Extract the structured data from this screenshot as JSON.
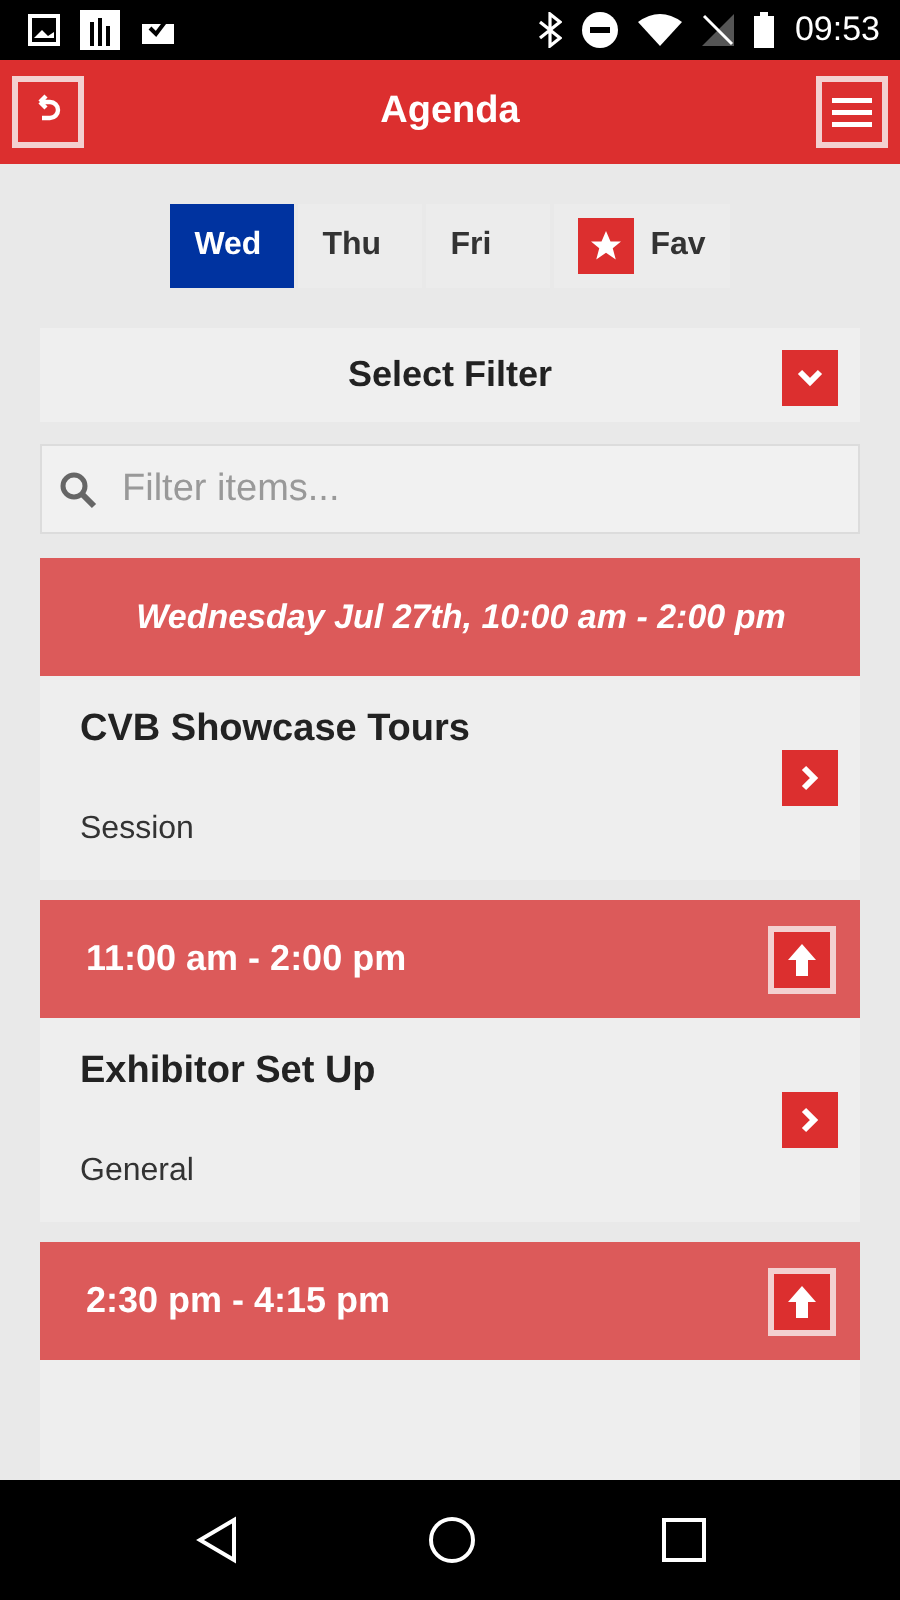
{
  "status_bar": {
    "time": "09:53"
  },
  "header": {
    "title": "Agenda"
  },
  "tabs": [
    {
      "label": "Wed",
      "selected": true,
      "kind": "day"
    },
    {
      "label": "Thu",
      "selected": false,
      "kind": "day"
    },
    {
      "label": "Fri",
      "selected": false,
      "kind": "day"
    },
    {
      "label": "Fav",
      "selected": false,
      "kind": "favorites"
    }
  ],
  "filter": {
    "label": "Select Filter",
    "expanded": false
  },
  "search": {
    "placeholder": "Filter items..."
  },
  "sections": [
    {
      "kind": "day",
      "title": "Wednesday Jul 27th, 10:00 am - 2:00 pm",
      "items": [
        {
          "title": "CVB Showcase Tours",
          "type": "Session"
        }
      ]
    },
    {
      "kind": "time",
      "title": "11:00 am - 2:00 pm",
      "items": [
        {
          "title": "Exhibitor Set Up",
          "type": "General"
        }
      ]
    },
    {
      "kind": "time",
      "title": "2:30 pm - 4:15 pm",
      "items": [
        {
          "kind": "partial"
        }
      ]
    }
  ]
}
